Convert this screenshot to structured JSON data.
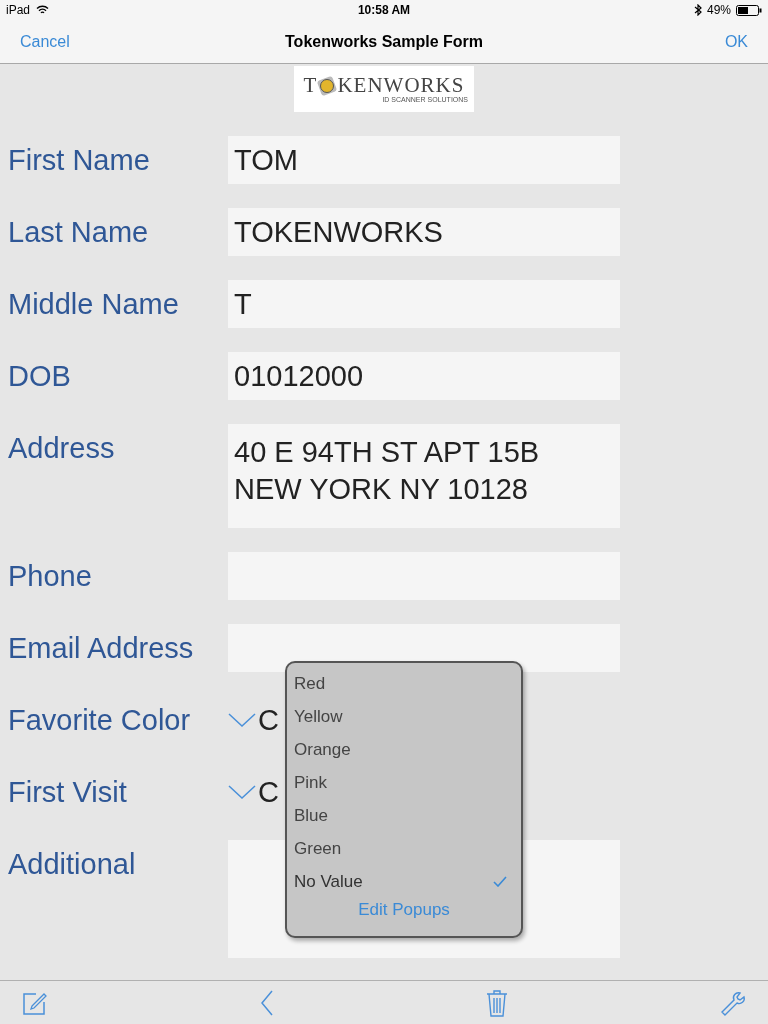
{
  "status_bar": {
    "device": "iPad",
    "time": "10:58 AM",
    "battery": "49%"
  },
  "nav_bar": {
    "cancel": "Cancel",
    "title": "Tokenworks Sample Form",
    "ok": "OK"
  },
  "logo": {
    "start": "T",
    "end": "KENWORKS",
    "tagline": "ID SCANNER SOLUTIONS"
  },
  "fields": [
    {
      "label": "First Name",
      "kind": "text",
      "value": "TOM"
    },
    {
      "label": "Last Name",
      "kind": "text",
      "value": "TOKENWORKS"
    },
    {
      "label": "Middle Name",
      "kind": "text",
      "value": "T"
    },
    {
      "label": "DOB",
      "kind": "text",
      "value": "01012000"
    },
    {
      "label": "Address",
      "kind": "multiline",
      "value": "40 E 94TH ST APT 15B\nNEW YORK NY 10128"
    },
    {
      "label": "Phone",
      "kind": "text"
    },
    {
      "label": "Email Address",
      "kind": "text"
    },
    {
      "label": "Favorite Color",
      "kind": "picker",
      "placeholder": "C"
    },
    {
      "label": "First Visit",
      "kind": "picker",
      "placeholder": "C"
    },
    {
      "label": "Additional",
      "kind": "note"
    }
  ],
  "popup": {
    "options": [
      {
        "label": "Red",
        "selected": false
      },
      {
        "label": "Yellow",
        "selected": false
      },
      {
        "label": "Orange",
        "selected": false
      },
      {
        "label": "Pink",
        "selected": false
      },
      {
        "label": "Blue",
        "selected": false
      },
      {
        "label": "Green",
        "selected": false
      },
      {
        "label": "No Value",
        "selected": true
      }
    ],
    "edit": "Edit Popups"
  }
}
